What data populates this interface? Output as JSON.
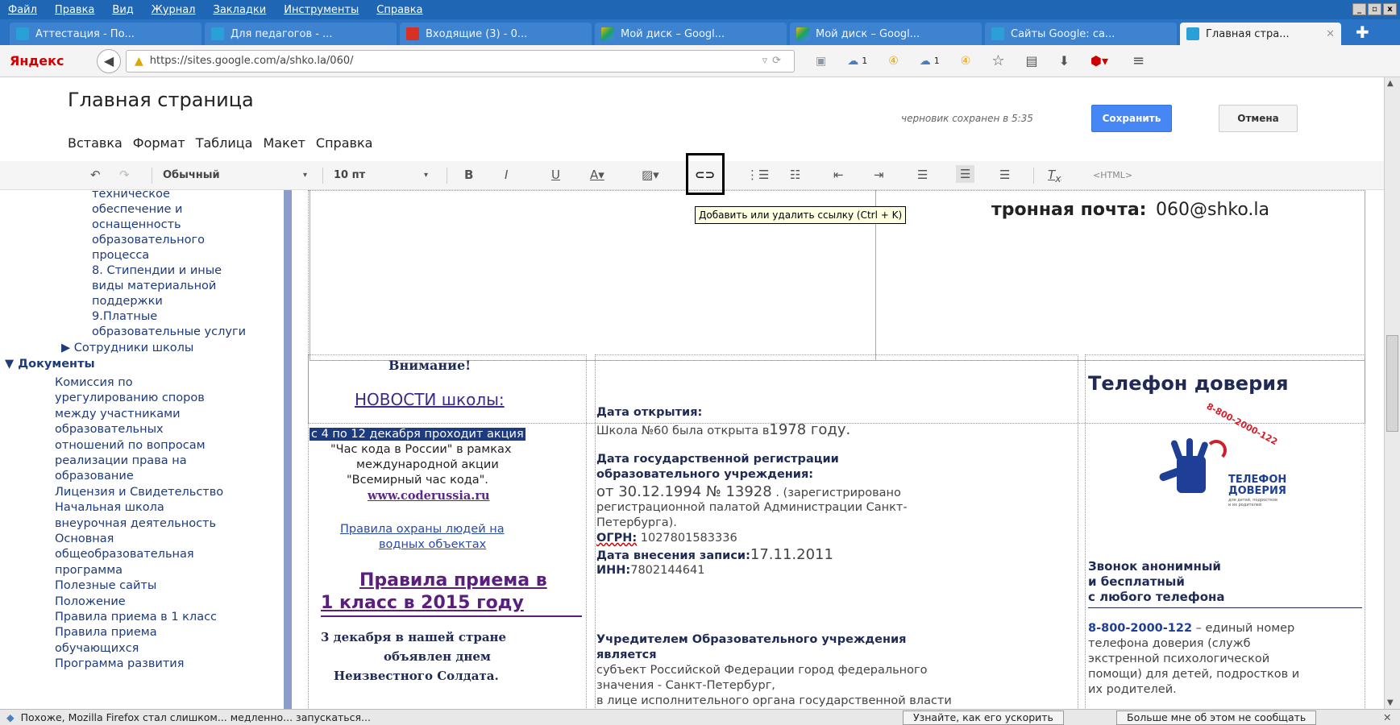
{
  "menubar": [
    "Файл",
    "Правка",
    "Вид",
    "Журнал",
    "Закладки",
    "Инструменты",
    "Справка"
  ],
  "tabs": [
    {
      "label": "Аттестация - По...",
      "color": "#29a0d8"
    },
    {
      "label": "Для педагогов - ...",
      "color": "#29a0d8"
    },
    {
      "label": "Входящие (3) - 0...",
      "color": "#d93025"
    },
    {
      "label": "Мой диск – Googl...",
      "color": "#f2b705"
    },
    {
      "label": "Мой диск – Googl...",
      "color": "#f2b705"
    },
    {
      "label": "Сайты Google: са...",
      "color": "#29a0d8"
    },
    {
      "label": "Главная стра...",
      "color": "#29a0d8"
    }
  ],
  "nav": {
    "brand": "Яндекс",
    "url": "https://sites.google.com/a/shko.la/060/",
    "badge1": "1",
    "badge2": "1"
  },
  "editor": {
    "title": "Главная страница",
    "draft": "черновик сохранен в 5:35",
    "save": "Сохранить",
    "cancel": "Отмена",
    "menu": [
      "Вставка",
      "Формат",
      "Таблица",
      "Макет",
      "Справка"
    ],
    "style": "Обычный",
    "size": "10 пт",
    "html": "<HTML>",
    "tooltip": "Добавить или удалить ссылку (Ctrl + K)"
  },
  "sidebar": {
    "top_items": [
      "техническое",
      "обеспечение и",
      "оснащенность",
      "образовательного",
      "процесса",
      "8. Стипендии и иные",
      "виды материальной",
      "поддержки",
      "9.Платные",
      "образовательные услуги"
    ],
    "staff": "▶ Сотрудники школы",
    "docs": "▼ Документы",
    "doc_items": [
      "Комиссия по",
      "урегулированию споров",
      "между участниками",
      "образовательных",
      "отношений по вопросам",
      "реализации права на",
      "образование",
      "Лицензия и Свидетельство",
      "Начальная школа",
      "внеурочная деятельность",
      "Основная",
      "общеобразовательная",
      "программа",
      "Полезные сайты",
      "Положение",
      "Правила приема в 1 класс",
      "Правила приема",
      "обучающихся",
      "Программа развития"
    ]
  },
  "email": {
    "label": "тронная почта:",
    "value": "060@shko.la"
  },
  "news": {
    "attention": "Внимание!",
    "heading": "НОВОСТИ школы:",
    "highlight": "с 4 по 12 декабря проходит акция",
    "lines": [
      "\"Час кода в России\" в рамках",
      "международной акции",
      "\"Всемирный час кода\"."
    ],
    "site": "www.coderussia.ru",
    "rules1": "Правила охраны людей на",
    "rules2": "водных объектах",
    "admission1": "Правила приема в",
    "admission2": "1 класс в 2015 году",
    "soldier": [
      "3 декабря в нашей стране",
      "объявлен днем",
      "Неизвестного Солдата."
    ]
  },
  "info": {
    "opened_label": "Дата открытия:",
    "opened_text": "Школа №60 была открыта в",
    "opened_year": "1978 году.",
    "reg_label1": "Дата государственной регистрации",
    "reg_label2": "образовательного учреждения:",
    "reg_text1a": "от 30.12.1994  № 13928",
    "reg_text1b": " . (зарегистрировано",
    "reg_text2": "регистрационной палатой Администрации Санкт-",
    "reg_text3": "Петербурга).",
    "ogrn_label": "ОГРН:",
    "ogrn": " 1027801583336",
    "entry_label": "Дата внесения записи:",
    "entry": "17.11.2011",
    "inn_label": "ИНН:",
    "inn": "7802144641",
    "founder1": "Учредителем Образовательного учреждения",
    "founder2": "является",
    "founder3": "субъект Российской Федерации город федерального",
    "founder4": "значения - Санкт-Петербург,",
    "founder5": "в лице исполнительного органа государственной власти"
  },
  "hotline": {
    "title": "Телефон доверия",
    "logo_num": "8-800-2000-122",
    "logo_t1": "ТЕЛЕФОН",
    "logo_t2": "ДОВЕРИЯ",
    "logo_sub1": "для детей, подростков",
    "logo_sub2": "и их родителей",
    "call1": "Звонок анонимный",
    "call2": "и бесплатный",
    "call3": "с любого телефона",
    "num": "8-800-2000-122",
    "desc0": " – единый номер",
    "desc1": "телефона доверия (служб",
    "desc2": "экстренной психологической",
    "desc3": "помощи) для детей, подростков и",
    "desc4": "их родителей."
  },
  "footer": {
    "msg": "Похоже, Mozilla Firefox стал слишком... медленно... запускаться...",
    "btn1": "Узнайте, как его ускорить",
    "btn2": "Больше мне об этом не сообщать"
  }
}
